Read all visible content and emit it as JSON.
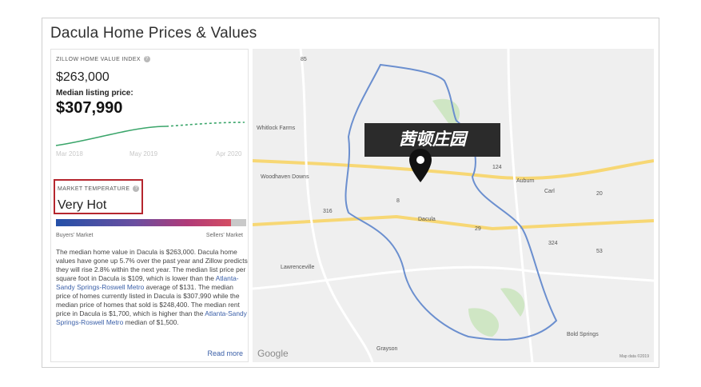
{
  "page": {
    "title": "Dacula Home Prices & Values"
  },
  "left_panel": {
    "zhvi_header": "ZILLOW HOME VALUE INDEX",
    "zhvi_value": "$263,000",
    "median_listing_label": "Median listing price:",
    "median_listing_value": "$307,990",
    "chart_axis": [
      "Mar 2018",
      "May 2019",
      "Apr 2020"
    ],
    "market_temp_header": "MARKET TEMPERATURE",
    "market_temp_value": "Very Hot",
    "temp_scale_left": "Buyers' Market",
    "temp_scale_right": "Sellers' Market",
    "temp_level_fraction": 0.92,
    "description_parts": [
      "The median home value in Dacula is $263,000. Dacula home values have gone up 5.7% over the past year and Zillow predicts they will rise 2.8% within the next year. The median list price per square foot in Dacula is $109, which is lower than the ",
      "Atlanta-Sandy Springs-Roswell Metro",
      " average of $131. The median price of homes currently listed in Dacula is $307,990 while the median price of homes that sold is $248,400. The median rent price in Dacula is $1,700, which is higher than the ",
      "Atlanta-Sandy Springs-Roswell Metro",
      " median of $1,500."
    ],
    "read_more": "Read more"
  },
  "map": {
    "overlay_label": "茜顿庄园",
    "pin_icon": "map-pin-icon",
    "places": [
      "Whitlock Farms",
      "Woodhaven Downs",
      "Dacula",
      "Lawrenceville",
      "Auburn",
      "Carl",
      "Grayson",
      "Bold Springs"
    ],
    "roads": [
      "85",
      "316",
      "29",
      "20",
      "124",
      "8",
      "324",
      "53"
    ],
    "google": "Google",
    "map_data": "Map data ©2019"
  },
  "colors": {
    "accent": "#b5262e",
    "link": "#3a5fa8",
    "chart_line": "#3aa56a"
  }
}
